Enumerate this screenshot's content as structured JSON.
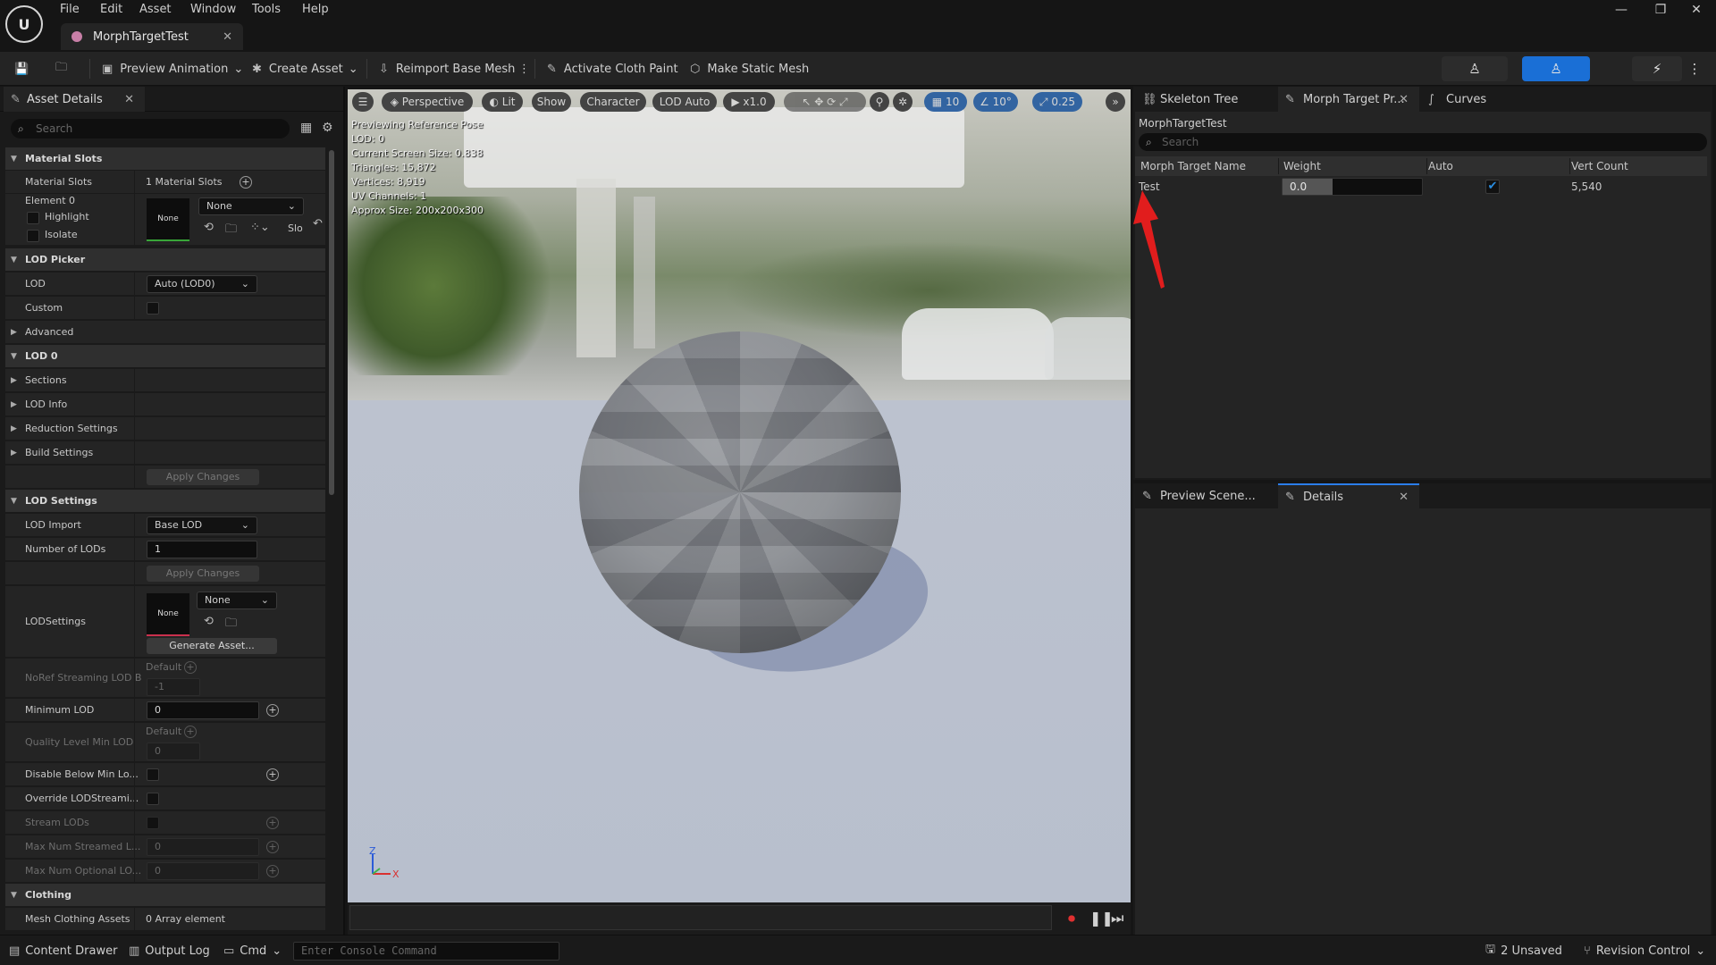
{
  "menu": [
    "File",
    "Edit",
    "Asset",
    "Window",
    "Tools",
    "Help"
  ],
  "document_tab": {
    "title": "MorphTargetTest"
  },
  "toolbar": {
    "preview_animation": "Preview Animation",
    "create_asset": "Create Asset",
    "reimport": "Reimport Base Mesh",
    "cloth_paint": "Activate Cloth Paint",
    "static_mesh": "Make Static Mesh"
  },
  "left_panel": {
    "tab": "Asset Details",
    "search_placeholder": "Search",
    "material_slots_cat": "Material Slots",
    "material_slots_label": "Material Slots",
    "material_slots_value": "1 Material Slots",
    "element0": "Element 0",
    "highlight": "Highlight",
    "isolate": "Isolate",
    "thumb_none": "None",
    "material_dropdown": "None",
    "slot_short": "Slo",
    "lod_picker_cat": "LOD Picker",
    "lod": "LOD",
    "lod_value": "Auto (LOD0)",
    "custom": "Custom",
    "advanced": "Advanced",
    "lod0_cat": "LOD 0",
    "sections": "Sections",
    "lod_info": "LOD Info",
    "reduction": "Reduction Settings",
    "build": "Build Settings",
    "apply_changes": "Apply Changes",
    "lod_settings_cat": "LOD Settings",
    "lod_import": "LOD Import",
    "lod_import_value": "Base LOD",
    "num_lods": "Number of LODs",
    "num_lods_value": "1",
    "lodsettings": "LODSettings",
    "lodsettings_thumb": "None",
    "lodsettings_dropdown": "None",
    "generate_asset": "Generate Asset...",
    "noref": "NoRef Streaming LOD B",
    "default_label": "Default",
    "noref_value": "-1",
    "min_lod": "Minimum LOD",
    "min_lod_value": "0",
    "quality_min_lod": "Quality Level Min LOD",
    "quality_default": "Default",
    "quality_value": "0",
    "disable_below": "Disable Below Min Lo...",
    "override_streaming": "Override LODStreami...",
    "stream_lods": "Stream LODs",
    "max_streamed": "Max Num Streamed L...",
    "max_streamed_value": "0",
    "max_optional": "Max Num Optional LO...",
    "max_optional_value": "0",
    "clothing_cat": "Clothing",
    "mesh_clothing": "Mesh Clothing Assets",
    "mesh_clothing_value": "0 Array element"
  },
  "viewport": {
    "perspective": "Perspective",
    "lit": "Lit",
    "show": "Show",
    "character": "Character",
    "lod_auto": "LOD Auto",
    "speed": "x1.0",
    "grid": "10",
    "angle": "10°",
    "scale": "0.25",
    "stats": [
      "Previewing Reference Pose",
      "LOD: 0",
      "Current Screen Size: 0.838",
      "Triangles: 15,872",
      "Vertices: 8,919",
      "UV Channels: 1",
      "Approx Size: 200x200x300"
    ],
    "axis_z": "Z",
    "axis_x": "X"
  },
  "right_top": {
    "tabs": [
      "Skeleton Tree",
      "Morph Target Pr...",
      "Curves"
    ],
    "asset_name": "MorphTargetTest",
    "search_placeholder": "Search",
    "columns": [
      "Morph Target Name",
      "Weight",
      "Auto",
      "Vert Count"
    ],
    "row": {
      "name": "Test",
      "weight": "0.0",
      "weight_fraction": 0.36,
      "auto": true,
      "vert_count": "5,540"
    }
  },
  "right_bottom": {
    "tabs": [
      "Preview Scene...",
      "Details"
    ]
  },
  "statusbar": {
    "content_drawer": "Content Drawer",
    "output_log": "Output Log",
    "cmd": "Cmd",
    "console_placeholder": "Enter Console Command",
    "unsaved": "2 Unsaved",
    "revision": "Revision Control"
  },
  "colors": {
    "accent": "#2b7de9",
    "arrow": "#e11d1d",
    "active_button": "#1a6fd6"
  }
}
